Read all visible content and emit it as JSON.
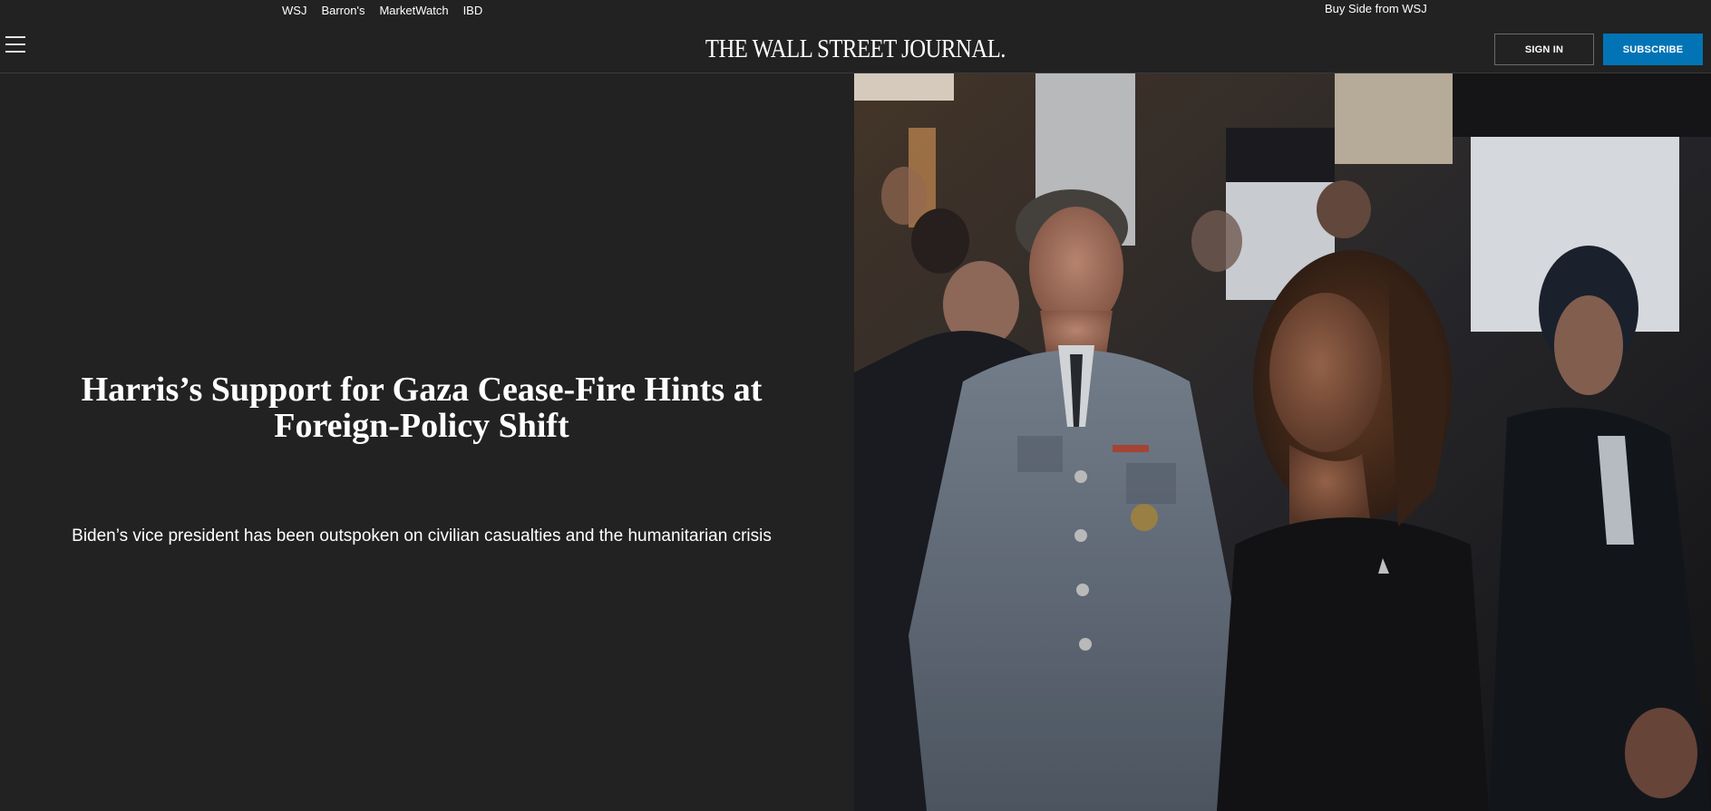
{
  "utility": {
    "brand_links": [
      "WSJ",
      "Barron's",
      "MarketWatch",
      "IBD"
    ],
    "buy_side": "Buy Side from WSJ"
  },
  "masthead": {
    "logo": "THE WALL STREET JOURNAL.",
    "sign_in": "SIGN IN",
    "subscribe": "SUBSCRIBE",
    "subscribe_color": "#0274b6"
  },
  "hero": {
    "headline": "Harris’s Support for Gaza Cease-Fire Hints at Foreign-Policy Shift",
    "dek": "Biden’s vice president has been outspoken on civilian casualties and the humanitarian crisis"
  }
}
